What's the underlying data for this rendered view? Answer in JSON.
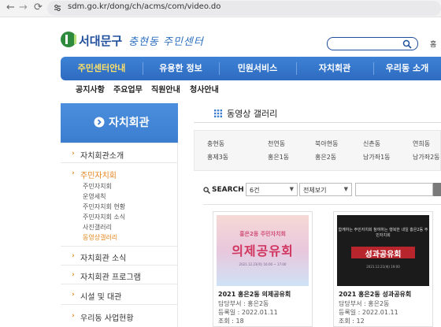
{
  "browser": {
    "back_glyph": "←",
    "forward_glyph": "→",
    "reload_glyph": "⟳",
    "url": "sdm.go.kr/dong/ch/acms/com/video.do"
  },
  "header": {
    "logo_text": "서대문구",
    "logo_sub": "충현동 주민센터",
    "top_link": "홈"
  },
  "gnb": {
    "items": [
      "주민센터안내",
      "유용한 정보",
      "민원서비스",
      "자치회관",
      "우리동 소개"
    ]
  },
  "sub_nav": {
    "items": [
      "공지사항",
      "주요업무",
      "직원안내",
      "청사안내"
    ]
  },
  "lnb": {
    "title": "자치회관",
    "items": [
      {
        "label": "자치회관소개"
      },
      {
        "label": "주민자치회"
      },
      {
        "label": "자치회관 소식"
      },
      {
        "label": "자치회관 프로그램"
      },
      {
        "label": "시설 및 대관"
      },
      {
        "label": "우리동 사업현황"
      }
    ],
    "sub_items": [
      "주민자치회",
      "운영세칙",
      "주민자치회 현황",
      "주민자치회 소식",
      "사진갤러리",
      "동영상갤러리"
    ]
  },
  "content": {
    "title": "동영상 갤러리",
    "dong_rows": [
      [
        "충현동",
        "천연동",
        "북아현동",
        "신촌동",
        "연희동"
      ],
      [
        "홍제3동",
        "홍은1동",
        "홍은2동",
        "남가좌1동",
        "남가좌2동"
      ]
    ],
    "search_label": "SEARCH",
    "count_select": "6건",
    "scope_select": "전체보기"
  },
  "cards": [
    {
      "thumb_small": "홍은2동 주민자치회",
      "thumb_big": "의제공유회",
      "thumb_foot": "2021.12.23(목) 16:00 ~ 17:00",
      "title": "2021 홍은2동 의제공유회",
      "dept": "담당부서 : 홍은2동",
      "date": "등록일 : 2022.01.11",
      "views": "조회 : 18"
    },
    {
      "thumb_small": "함께하는 주민자치회 참여하는 행복한 내일 홍은2동 주민자치회",
      "thumb_big": "성과공유회",
      "thumb_foot": "2021.12.21(화) 19:00",
      "title": "2021 홍은2동 성과공유회",
      "dept": "담당부서 : 홍은2동",
      "date": "등록일 : 2022.01.11",
      "views": "조회 : 12"
    }
  ],
  "colors": {
    "brand_blue": "#2e6bc0",
    "accent_orange": "#e6851e",
    "active_gnb": "#ffe066"
  }
}
